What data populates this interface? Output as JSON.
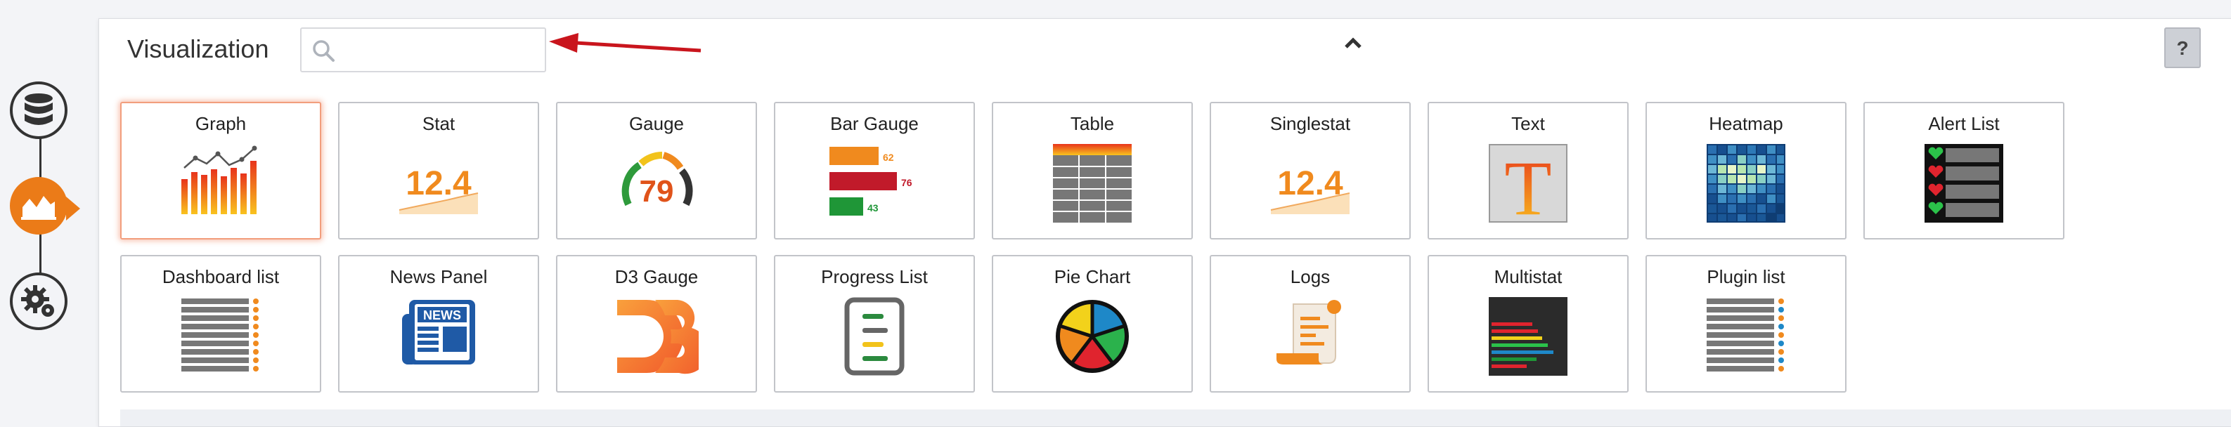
{
  "sidenav": {
    "items": [
      {
        "name": "data-sources",
        "icon": "database-icon",
        "active": false
      },
      {
        "name": "visualization",
        "icon": "chart-area-icon",
        "active": true
      },
      {
        "name": "settings",
        "icon": "gear-icon",
        "active": false
      }
    ],
    "accent": "#eb7b18"
  },
  "header": {
    "title": "Visualization",
    "search_placeholder": "",
    "search_value": "",
    "help_label": "?"
  },
  "visualizations": [
    {
      "label": "Graph",
      "icon": "graph-icon",
      "selected": true
    },
    {
      "label": "Stat",
      "icon": "stat-icon",
      "selected": false
    },
    {
      "label": "Gauge",
      "icon": "gauge-icon",
      "selected": false
    },
    {
      "label": "Bar Gauge",
      "icon": "bar-gauge-icon",
      "selected": false
    },
    {
      "label": "Table",
      "icon": "table-icon",
      "selected": false
    },
    {
      "label": "Singlestat",
      "icon": "singlestat-icon",
      "selected": false
    },
    {
      "label": "Text",
      "icon": "text-icon",
      "selected": false
    },
    {
      "label": "Heatmap",
      "icon": "heatmap-icon",
      "selected": false
    },
    {
      "label": "Alert List",
      "icon": "alert-list-icon",
      "selected": false
    },
    {
      "label": "Dashboard list",
      "icon": "dashboard-list-icon",
      "selected": false
    },
    {
      "label": "News Panel",
      "icon": "news-icon",
      "selected": false
    },
    {
      "label": "D3 Gauge",
      "icon": "d3-icon",
      "selected": false
    },
    {
      "label": "Progress List",
      "icon": "progress-list-icon",
      "selected": false
    },
    {
      "label": "Pie Chart",
      "icon": "pie-chart-icon",
      "selected": false
    },
    {
      "label": "Logs",
      "icon": "logs-icon",
      "selected": false
    },
    {
      "label": "Multistat",
      "icon": "multistat-icon",
      "selected": false
    },
    {
      "label": "Plugin list",
      "icon": "plugin-list-icon",
      "selected": false
    }
  ],
  "icon_text": {
    "stat_value": "12.4",
    "gauge_value": "79",
    "bar_gauge_values": [
      "62",
      "76",
      "43"
    ],
    "singlestat_value": "12.4",
    "text_glyph": "T",
    "news_word": "NEWS",
    "d3_word": "D3"
  }
}
